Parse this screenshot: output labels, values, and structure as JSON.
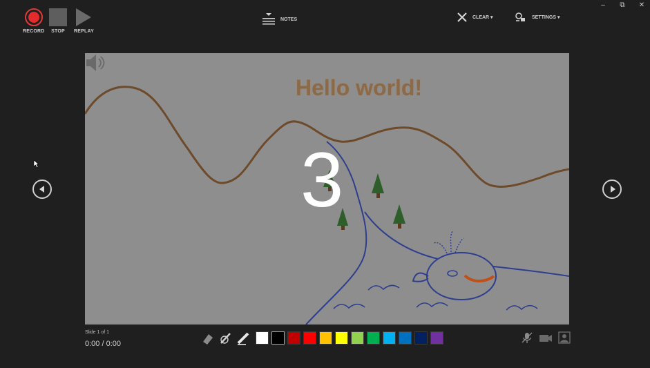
{
  "toolbar": {
    "record_label": "RECORD",
    "stop_label": "STOP",
    "replay_label": "REPLAY",
    "notes_label": "NOTES",
    "clear_label": "CLEAR ▾",
    "settings_label": "SETTINGS ▾"
  },
  "window": {
    "minimize": "–",
    "restore": "⧉",
    "close": "✕"
  },
  "slide": {
    "title": "Hello world!",
    "countdown": "3",
    "info": "Slide 1 of 1",
    "timer": "0:00  /  0:00"
  },
  "palette": [
    "#ffffff",
    "#000000",
    "#c00000",
    "#ff0000",
    "#ffc000",
    "#ffff00",
    "#92d050",
    "#00b050",
    "#00b0f0",
    "#0070c0",
    "#002060",
    "#7030a0"
  ],
  "colors": {
    "record": "#e52b2b",
    "background": "#1f1f1f"
  }
}
